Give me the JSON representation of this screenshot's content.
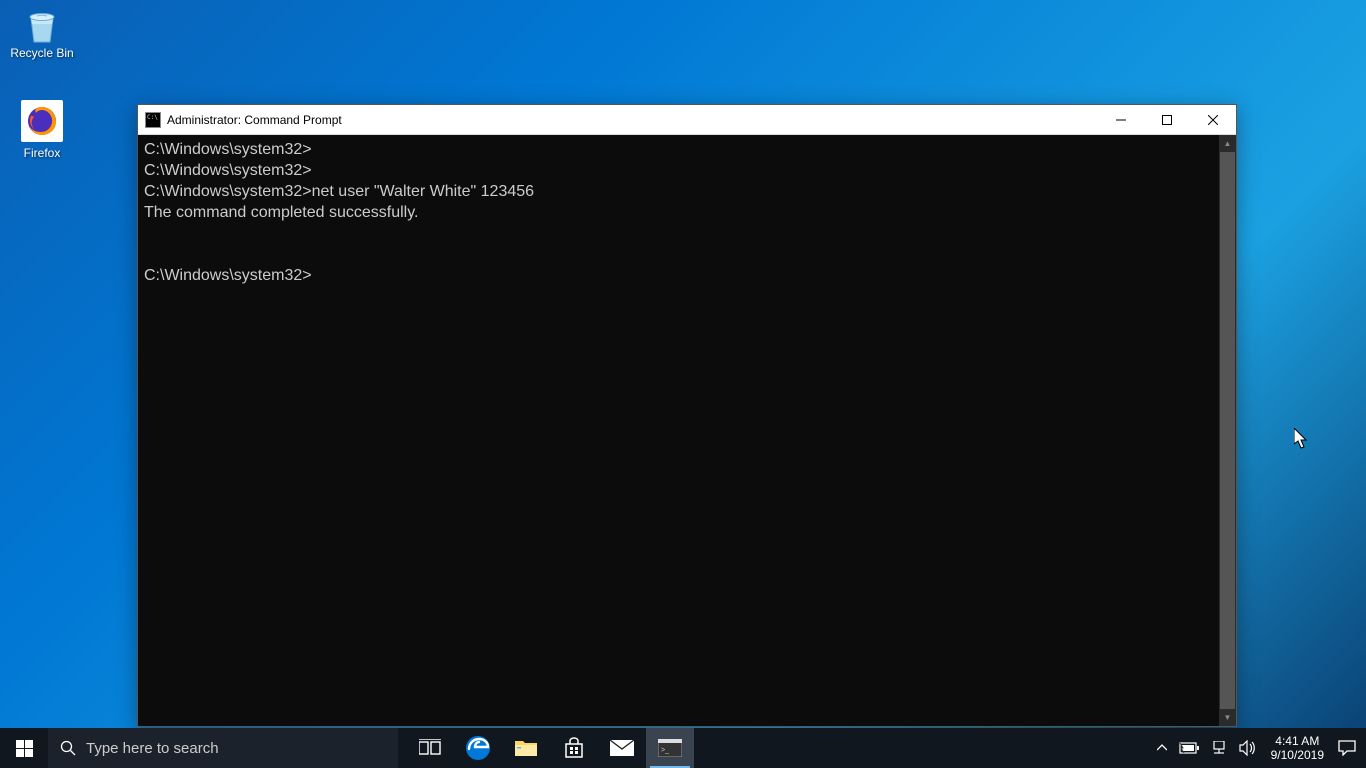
{
  "desktop": {
    "icons": [
      {
        "name": "recycle-bin",
        "label": "Recycle Bin"
      },
      {
        "name": "firefox",
        "label": "Firefox"
      }
    ]
  },
  "window": {
    "title": "Administrator: Command Prompt",
    "lines": [
      "C:\\Windows\\system32>",
      "C:\\Windows\\system32>",
      "C:\\Windows\\system32>net user \"Walter White\" 123456",
      "The command completed successfully.",
      "",
      "",
      "C:\\Windows\\system32>"
    ]
  },
  "taskbar": {
    "search_placeholder": "Type here to search",
    "apps": [
      {
        "name": "task-view",
        "icon": "task-view-icon"
      },
      {
        "name": "edge",
        "icon": "edge-icon"
      },
      {
        "name": "file-explorer",
        "icon": "folder-icon"
      },
      {
        "name": "microsoft-store",
        "icon": "store-icon"
      },
      {
        "name": "mail",
        "icon": "mail-icon"
      },
      {
        "name": "command-prompt",
        "icon": "cmd-icon",
        "active": true
      }
    ]
  },
  "systray": {
    "time": "4:41 AM",
    "date": "9/10/2019"
  }
}
